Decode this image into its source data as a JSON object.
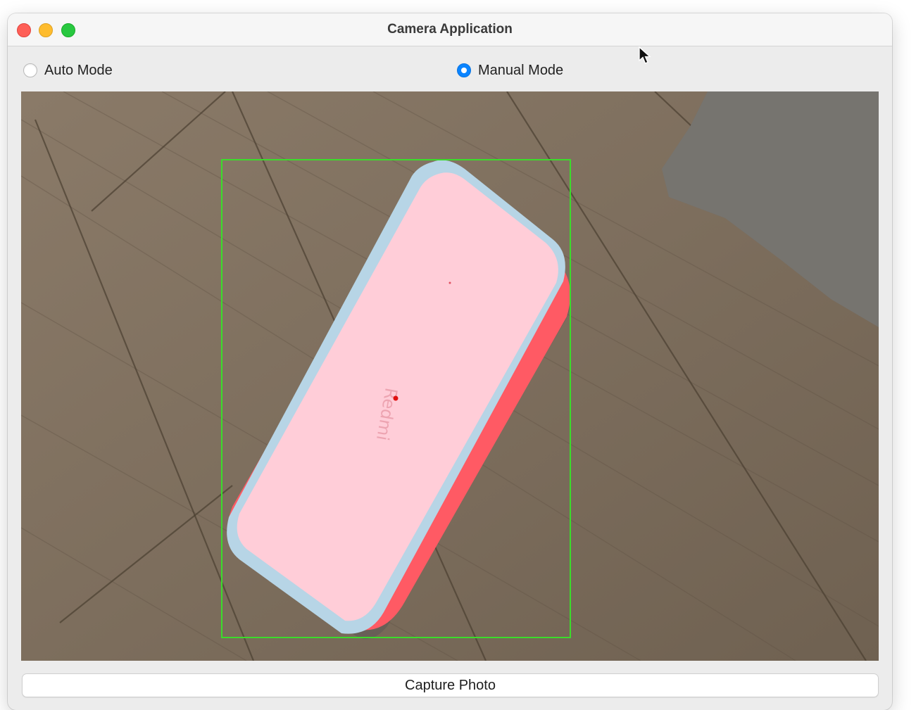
{
  "window": {
    "title": "Camera Application"
  },
  "modes": {
    "auto_label": "Auto Mode",
    "manual_label": "Manual Mode",
    "selected": "Manual Mode"
  },
  "camera": {
    "phone_brand_text": "Redmi",
    "bounding_box_color": "#3bdc2b",
    "mask_color": "#ff5a64",
    "center_point_color": "#e01010"
  },
  "actions": {
    "capture_label": "Capture Photo"
  },
  "colors": {
    "radio_selected": "#0a84ff",
    "close": "#fe5f57",
    "minimize": "#febc2e",
    "maximize": "#28c840"
  }
}
